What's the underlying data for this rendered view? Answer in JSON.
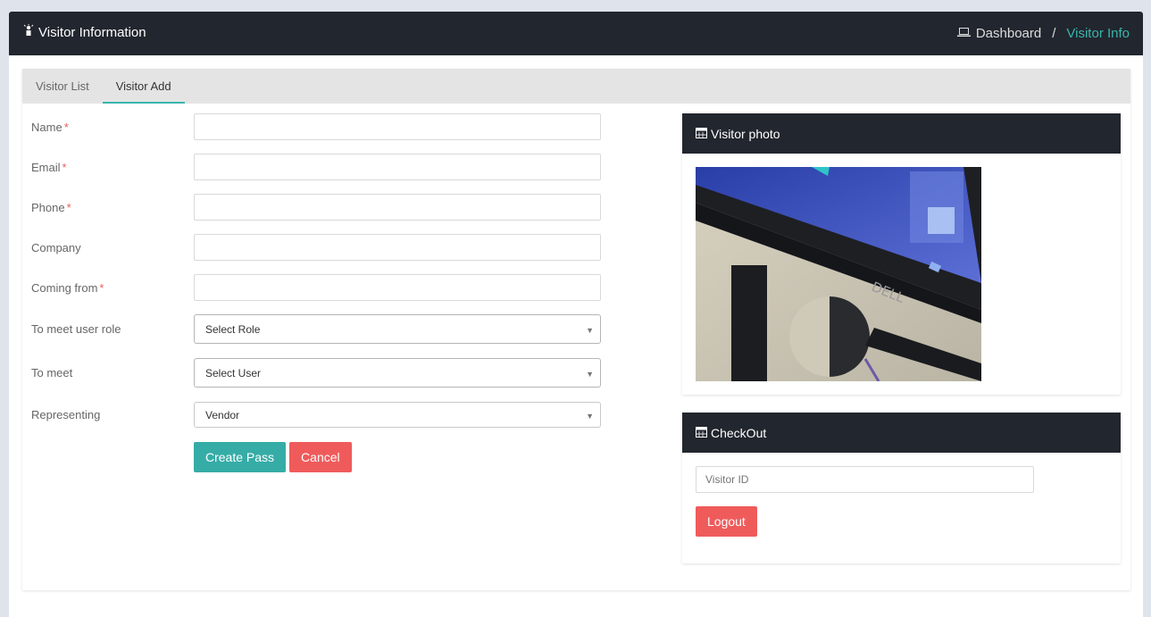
{
  "header": {
    "title": "Visitor Information",
    "breadcrumb_home": "Dashboard",
    "breadcrumb_sep": "/",
    "breadcrumb_current": "Visitor Info"
  },
  "tabs": [
    {
      "label": "Visitor List",
      "active": false
    },
    {
      "label": "Visitor Add",
      "active": true
    }
  ],
  "form": {
    "name_label": "Name",
    "email_label": "Email",
    "phone_label": "Phone",
    "company_label": "Company",
    "coming_from_label": "Coming from",
    "required_mark": "*",
    "role_label": "To meet user role",
    "role_value": "Select Role",
    "meet_label": "To meet",
    "meet_value": "Select User",
    "representing_label": "Representing",
    "representing_value": "Vendor",
    "create_button": "Create Pass",
    "cancel_button": "Cancel"
  },
  "photo_panel": {
    "title": "Visitor photo",
    "brand_text": "DELL"
  },
  "checkout_panel": {
    "title": "CheckOut",
    "visitor_id_placeholder": "Visitor ID",
    "logout_button": "Logout"
  },
  "colors": {
    "header_bg": "#22262e",
    "accent": "#3ab5ad",
    "danger": "#ef5b5b"
  }
}
